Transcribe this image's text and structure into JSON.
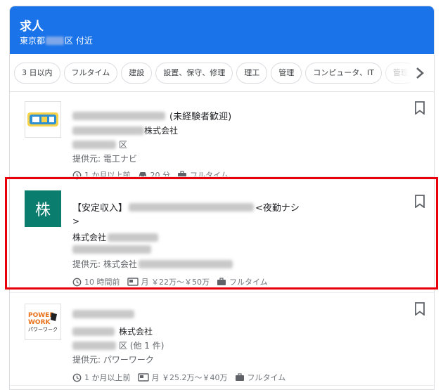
{
  "header": {
    "title": "求人",
    "location_prefix": "東京都",
    "location_suffix": "区 付近"
  },
  "chips": [
    "3 日以内",
    "フルタイム",
    "建設",
    "設置、保守、修理",
    "理工",
    "管理",
    "コンピュータ、IT",
    "管理"
  ],
  "jobs": [
    {
      "title_suffix": "(未経験者歓迎)",
      "company": "株式会社",
      "location_suffix": "区",
      "source": "提供元: 電工ナビ",
      "posted": "1 か月以上前",
      "commute": "20 分",
      "type": "フルタイム"
    },
    {
      "logo_char": "株",
      "title_prefix": "【安定収入】",
      "title_suffix": "<夜勤ナシ",
      "title_line2": ">",
      "company": "株式会社",
      "source": "提供元: 株式会社",
      "posted": "10 時間前",
      "salary": "月 ￥22万～￥50万",
      "type": "フルタイム"
    },
    {
      "company": "株式会社",
      "location_suffix": "区 (他 1 件)",
      "source": "提供元: パワーワーク",
      "posted": "1 か月以上前",
      "salary": "月 ￥25.2万～￥40万",
      "type": "フルタイム"
    }
  ],
  "colors": {
    "header": "#1a73e8",
    "highlight": "#e8000b",
    "logo_teal": "#0b7d6e"
  }
}
